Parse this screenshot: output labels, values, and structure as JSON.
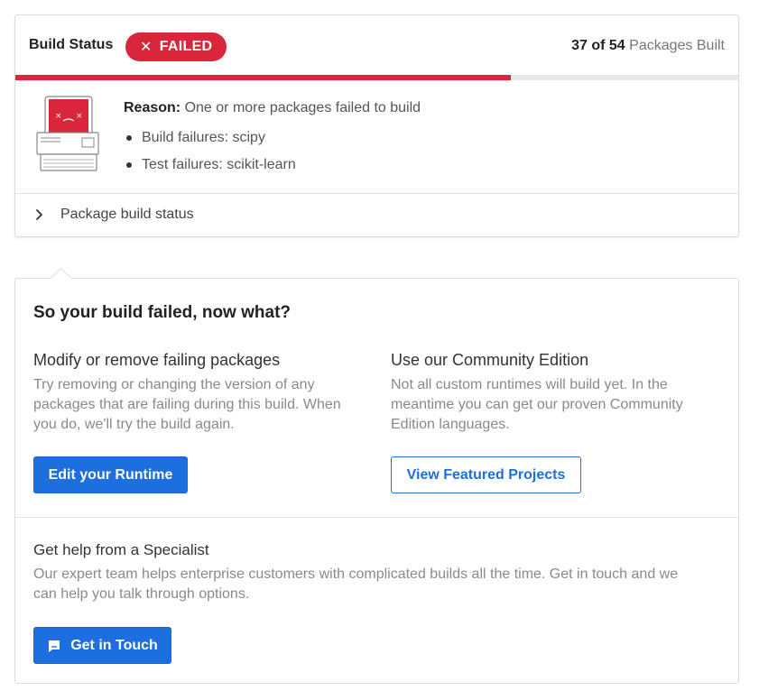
{
  "status": {
    "label": "Build Status",
    "badge": "FAILED",
    "badge_icon": "close-icon",
    "built": "37 of 54",
    "built_suffix": "Packages Built",
    "progress_fraction": 0.6852,
    "colors": {
      "failed": "#d9263b",
      "primary": "#1d6fe0"
    }
  },
  "reason": {
    "label": "Reason:",
    "text": "One or more packages failed to build",
    "failures": [
      "Build failures: scipy",
      "Test failures: scikit-learn"
    ]
  },
  "package_toggle": {
    "label": "Package build status",
    "icon": "chevron-right-icon"
  },
  "help": {
    "title": "So your build failed, now what?",
    "modify": {
      "title": "Modify or remove failing packages",
      "text_lines": [
        "Try removing or changing the version of any",
        "packages that are failing during this build. When",
        "you do, we'll try the build again."
      ],
      "button": "Edit your Runtime"
    },
    "community": {
      "title": "Use our Community Edition",
      "text_lines": [
        "Not all custom runtimes will build yet. In the",
        "meantime you can get our proven Community",
        "Edition languages."
      ],
      "button": "View Featured Projects"
    },
    "specialist": {
      "title": "Get help from a Specialist",
      "text_lines": [
        "Our expert team helps enterprise customers with complicated builds all the time. Get in touch and we",
        "can help you talk through options."
      ],
      "button": "Get in Touch",
      "button_icon": "chat-icon"
    }
  }
}
